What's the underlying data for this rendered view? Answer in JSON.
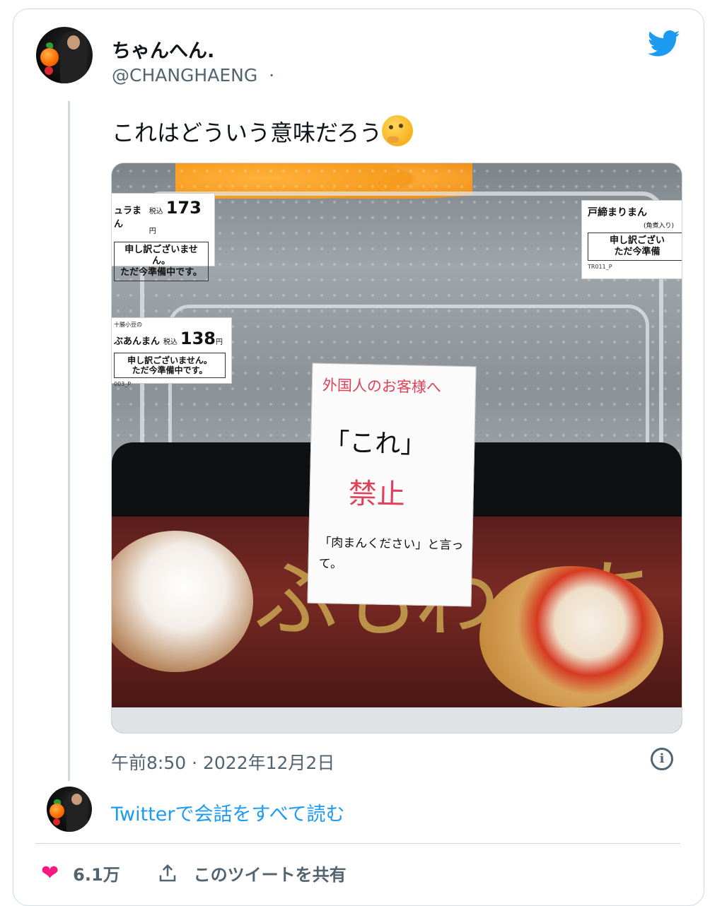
{
  "tweet": {
    "author_name": "ちゃんへん.",
    "author_handle": "@CHANGHAENG",
    "handle_separator": "·",
    "text": "これはどういう意味だろう",
    "emoji_icon": "thinking-face-icon",
    "timestamp": "午前8:50 · 2022年12月2日",
    "read_conversation": "Twitterで会話をすべて読む",
    "likes": "6.1万",
    "share_label": "このツイートを共有"
  },
  "photo": {
    "tag_left_top": {
      "name": "ュラまん",
      "tax_label": "税込",
      "price": "173",
      "unit": "円",
      "notice_1": "申し訳ございません。",
      "notice_2": "ただ今準備中です。"
    },
    "tag_left_mid": {
      "pre": "十勝小豆の",
      "name": "ぶあんまん",
      "tax_label": "税込",
      "price": "138",
      "unit": "円",
      "notice_1": "申し訳ございません。",
      "notice_2": "ただ今準備中です。",
      "code": "003_P"
    },
    "tag_right": {
      "name": "戸締まりまん",
      "sub": "(角煮入り)",
      "notice_1": "申し訳ござい",
      "notice_2": "ただ今準備",
      "code": "TR011_P"
    },
    "note": {
      "line1": "外国人のお客様へ",
      "line2": "「これ」",
      "line3": "禁止",
      "line4": "「肉まんください」と言って。"
    },
    "warmer_text": "ふもわっちっ"
  },
  "colors": {
    "accent": "#1d9bf0",
    "like": "#f91880",
    "muted": "#536471"
  }
}
